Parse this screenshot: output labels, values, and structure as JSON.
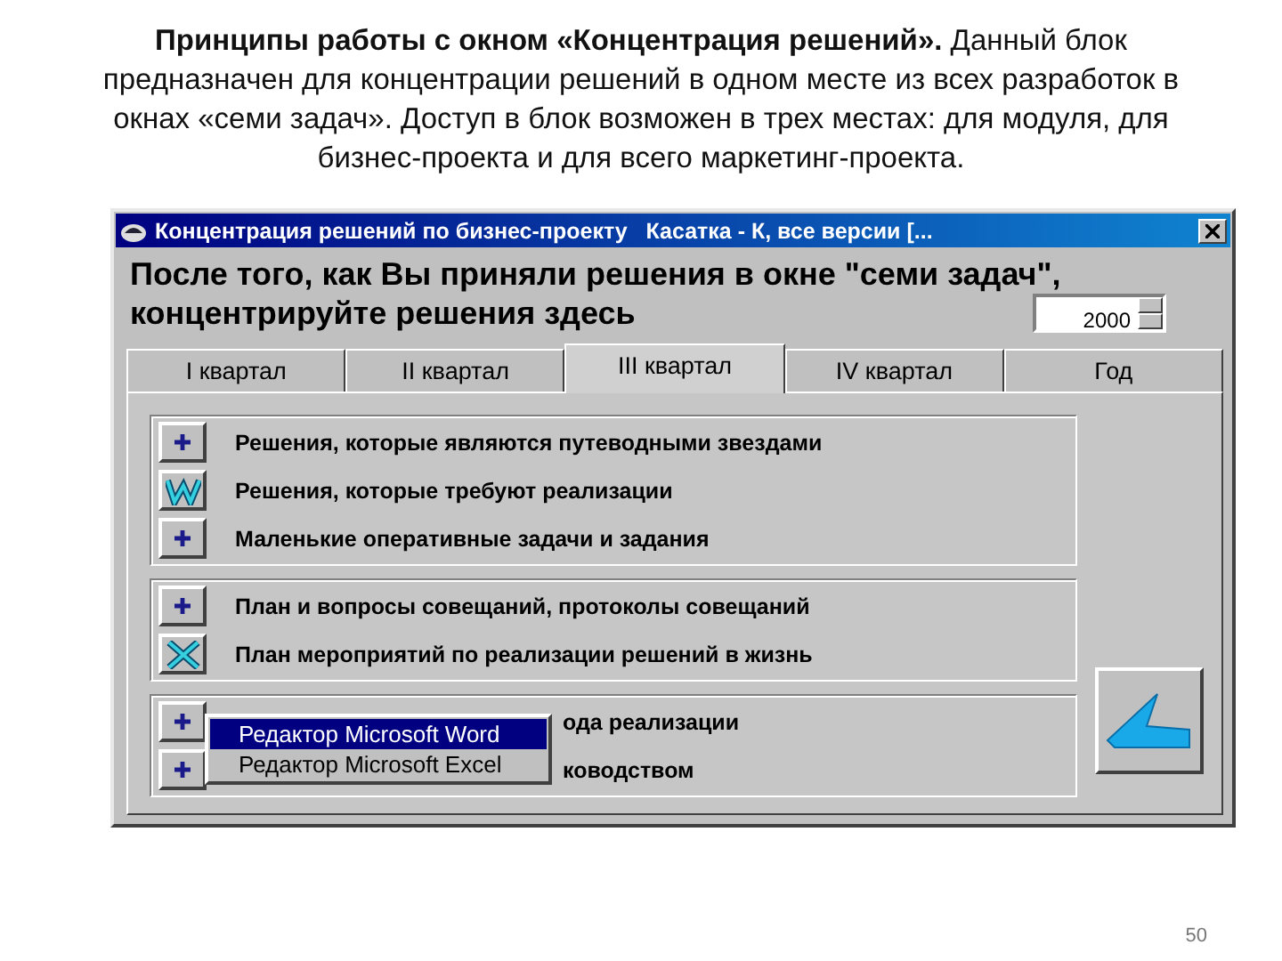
{
  "caption": "**Принципы работы с окном «Концентрация решений».** Данный блок предназначен для концентрации решений в одном месте из всех разработок в окнах «семи задач». Доступ в блок возможен в трех местах: для модуля, для бизнес-проекта и для всего маркетинг-проекта.",
  "window": {
    "title": "Концентрация решений по бизнес-проекту   Касатка - К, все версии [..."
  },
  "heading": [
    "После того, как Вы приняли решения в окне \"семи задач\",",
    "концентрируйте решения здесь"
  ],
  "year": "2000",
  "tabs": [
    {
      "label": "I квартал",
      "selected": false
    },
    {
      "label": "II квартал",
      "selected": false
    },
    {
      "label": "III квартал",
      "selected": true
    },
    {
      "label": "IV квартал",
      "selected": false
    },
    {
      "label": "Год",
      "selected": false
    }
  ],
  "groups": [
    {
      "rows": [
        {
          "kind": "plus",
          "label": "Решения, которые являются путеводными звездами"
        },
        {
          "kind": "word",
          "label": "Решения, которые требуют реализации"
        },
        {
          "kind": "plus",
          "label": "Маленькие оперативные задачи и задания"
        }
      ]
    },
    {
      "rows": [
        {
          "kind": "plus",
          "label": "План и вопросы совещаний, протоколы совещаний"
        },
        {
          "kind": "excel",
          "label": "План мероприятий по реализации решений в жизнь"
        }
      ]
    },
    {
      "rows": [
        {
          "kind": "plus",
          "label": "ода реализации"
        },
        {
          "kind": "plus",
          "label": "ководством"
        }
      ],
      "menu": [
        {
          "label": "Редактор Microsoft Word",
          "selected": true
        },
        {
          "label": "Редактор Microsoft Excel",
          "selected": false
        }
      ]
    }
  ],
  "page_number": "50"
}
